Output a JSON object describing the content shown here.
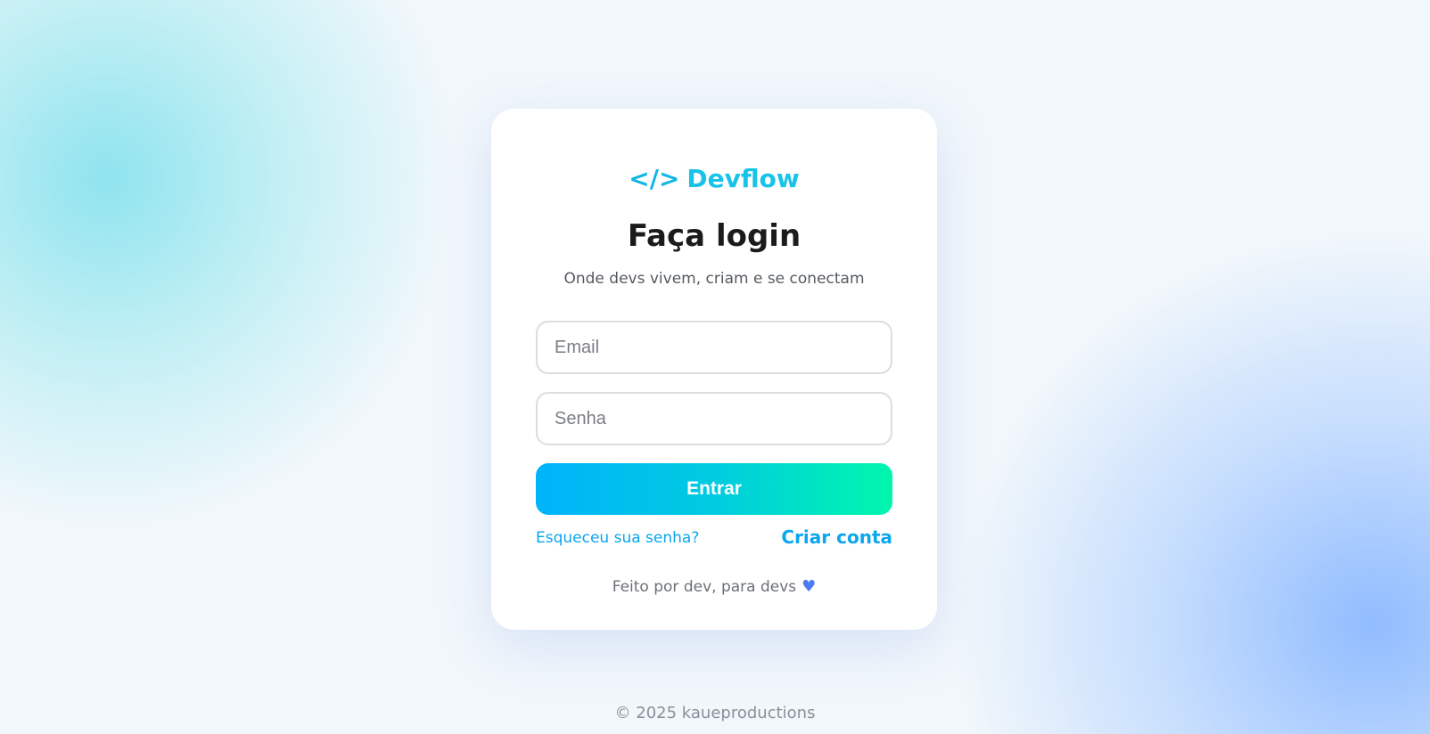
{
  "brand": {
    "icon": "</>",
    "name": "Devflow",
    "color": "#18c3e8"
  },
  "login": {
    "title": "Faça login",
    "subtitle": "Onde devs vivem, criam e se conectam",
    "email_placeholder": "Email",
    "password_placeholder": "Senha",
    "submit_label": "Entrar",
    "submit_gradient": [
      "#00b3fb",
      "#00f7ad"
    ],
    "forgot_label": "Esqueceu sua senha?",
    "create_label": "Criar conta",
    "link_color": "#0aa6ee",
    "tagline": "Feito por dev, para devs",
    "tagline_icon": "blue-heart-icon"
  },
  "footer": {
    "copyright": "© 2025 kaueproductions"
  }
}
